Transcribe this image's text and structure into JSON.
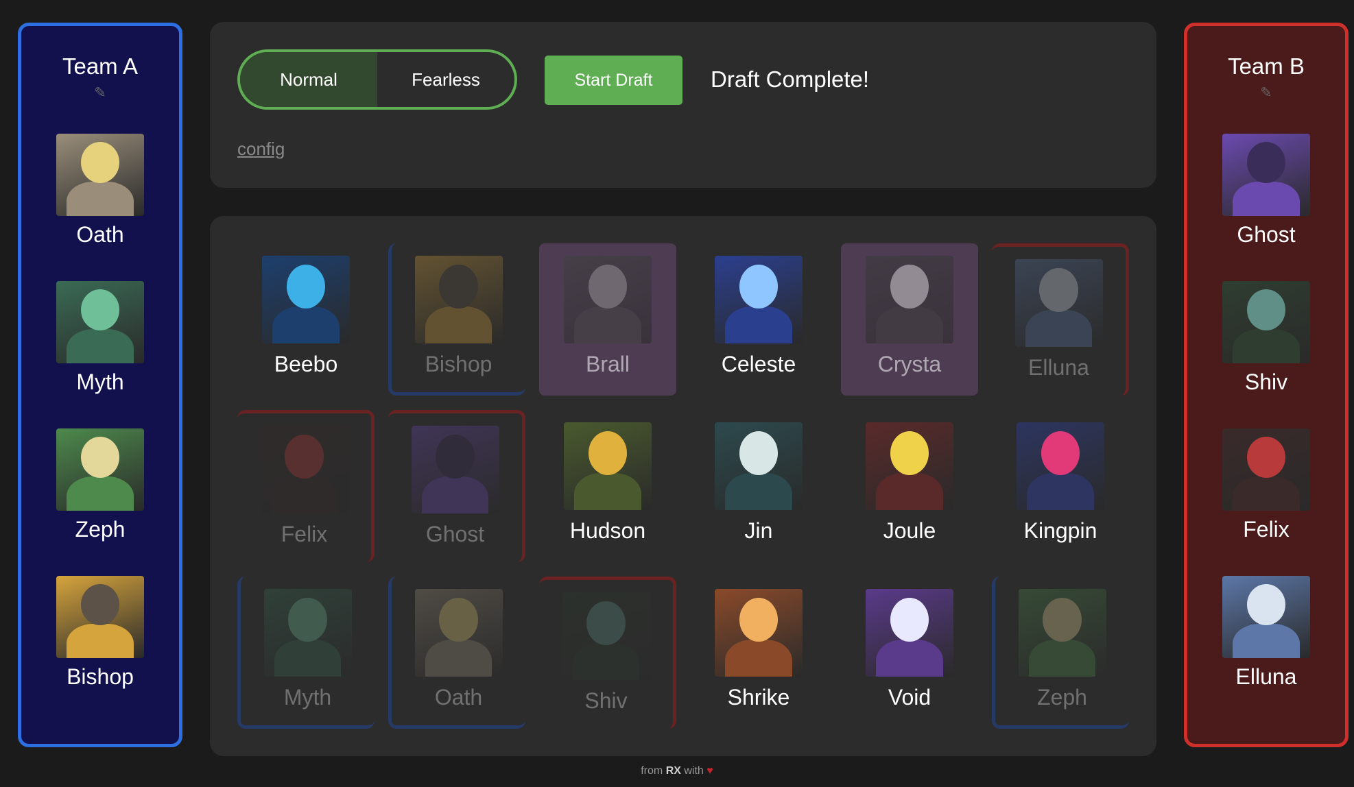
{
  "team_a": {
    "name": "Team A",
    "edit_icon": "pencil-icon",
    "picks": [
      {
        "name": "Oath",
        "colors": [
          "#e6d27c",
          "#9a8e7a"
        ]
      },
      {
        "name": "Myth",
        "colors": [
          "#6fbf98",
          "#3a6b55"
        ]
      },
      {
        "name": "Zeph",
        "colors": [
          "#e4d79a",
          "#4d8a4c"
        ]
      },
      {
        "name": "Bishop",
        "colors": [
          "#5d5247",
          "#d6a43c"
        ]
      }
    ]
  },
  "team_b": {
    "name": "Team B",
    "edit_icon": "pencil-icon",
    "picks": [
      {
        "name": "Ghost",
        "colors": [
          "#3a2d5a",
          "#6b4ab0"
        ]
      },
      {
        "name": "Shiv",
        "colors": [
          "#5f8f86",
          "#2f3d30"
        ]
      },
      {
        "name": "Felix",
        "colors": [
          "#b83a3a",
          "#3a2a2a"
        ]
      },
      {
        "name": "Elluna",
        "colors": [
          "#d9e4f0",
          "#5c77a8"
        ]
      }
    ]
  },
  "controls": {
    "mode_normal": "Normal",
    "mode_fearless": "Fearless",
    "active_mode": "Normal",
    "start_label": "Start Draft",
    "status": "Draft Complete!",
    "config_label": "config"
  },
  "heroes": [
    {
      "name": "Beebo",
      "state": "available",
      "colors": [
        "#3db0e8",
        "#1d3f6e"
      ]
    },
    {
      "name": "Bishop",
      "state": "picked-a",
      "colors": [
        "#5d5247",
        "#d6a43c"
      ]
    },
    {
      "name": "Brall",
      "state": "banned",
      "colors": [
        "#9a8a7a",
        "#4a3f36"
      ]
    },
    {
      "name": "Celeste",
      "state": "available",
      "colors": [
        "#8fc6ff",
        "#2b3f8f"
      ]
    },
    {
      "name": "Crysta",
      "state": "banned",
      "colors": [
        "#d8c7d0",
        "#3a3a3a"
      ]
    },
    {
      "name": "Elluna",
      "state": "picked-b",
      "colors": [
        "#d9e4f0",
        "#5c77a8"
      ]
    },
    {
      "name": "Felix",
      "state": "picked-b",
      "colors": [
        "#b83a3a",
        "#3a2a2a"
      ]
    },
    {
      "name": "Ghost",
      "state": "picked-b",
      "colors": [
        "#3a2d5a",
        "#6b4ab0"
      ]
    },
    {
      "name": "Hudson",
      "state": "available",
      "colors": [
        "#e0b13c",
        "#4a5a2e"
      ]
    },
    {
      "name": "Jin",
      "state": "available",
      "colors": [
        "#d9e6e6",
        "#2c4a4e"
      ]
    },
    {
      "name": "Joule",
      "state": "available",
      "colors": [
        "#f0d24a",
        "#5a2a2a"
      ]
    },
    {
      "name": "Kingpin",
      "state": "available",
      "colors": [
        "#e23a78",
        "#2d3560"
      ]
    },
    {
      "name": "Myth",
      "state": "picked-a",
      "colors": [
        "#6fbf98",
        "#3a6b55"
      ]
    },
    {
      "name": "Oath",
      "state": "picked-a",
      "colors": [
        "#e6d27c",
        "#9a8e7a"
      ]
    },
    {
      "name": "Shiv",
      "state": "picked-b",
      "colors": [
        "#5f8f86",
        "#2f3d30"
      ]
    },
    {
      "name": "Shrike",
      "state": "available",
      "colors": [
        "#f0b060",
        "#8a4a2a"
      ]
    },
    {
      "name": "Void",
      "state": "available",
      "colors": [
        "#e8e8ff",
        "#5a3a8a"
      ]
    },
    {
      "name": "Zeph",
      "state": "picked-a",
      "colors": [
        "#e4d79a",
        "#4d8a4c"
      ]
    }
  ],
  "footer": {
    "prefix": "from ",
    "brand": "RX",
    "suffix": " with ",
    "heart_icon": "heart-icon"
  }
}
